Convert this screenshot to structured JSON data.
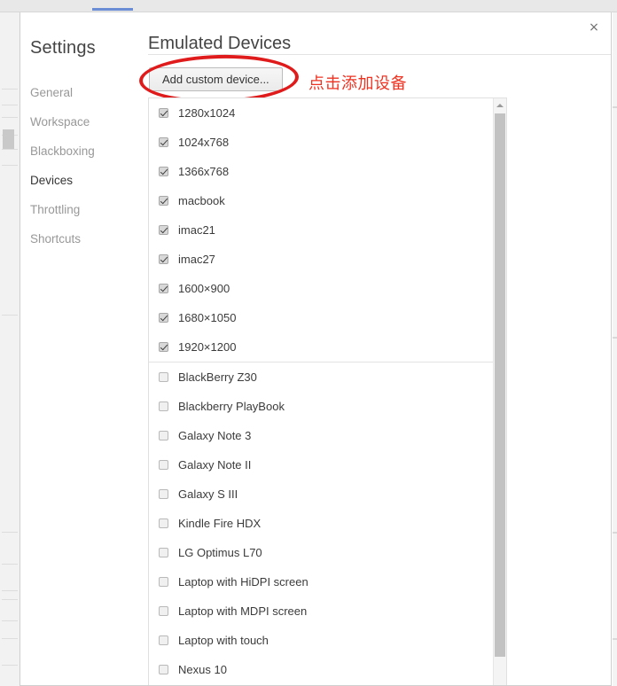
{
  "window": {
    "close_icon": "×"
  },
  "sidebar": {
    "title": "Settings",
    "items": [
      {
        "label": "General",
        "active": false
      },
      {
        "label": "Workspace",
        "active": false
      },
      {
        "label": "Blackboxing",
        "active": false
      },
      {
        "label": "Devices",
        "active": true
      },
      {
        "label": "Throttling",
        "active": false
      },
      {
        "label": "Shortcuts",
        "active": false
      }
    ]
  },
  "main": {
    "panel_title": "Emulated Devices",
    "add_custom_device_label": "Add custom device...",
    "annotation": {
      "text": "点击添加设备",
      "color": "#ee3322"
    },
    "device_groups": [
      {
        "name": "enabled-devices",
        "devices": [
          {
            "label": "1280x1024",
            "checked": true
          },
          {
            "label": "1024x768",
            "checked": true
          },
          {
            "label": "1366x768",
            "checked": true
          },
          {
            "label": "macbook",
            "checked": true
          },
          {
            "label": "imac21",
            "checked": true
          },
          {
            "label": "imac27",
            "checked": true
          },
          {
            "label": "1600×900",
            "checked": true
          },
          {
            "label": "1680×1050",
            "checked": true
          },
          {
            "label": "1920×1200",
            "checked": true
          }
        ]
      },
      {
        "name": "standard-devices",
        "devices": [
          {
            "label": "BlackBerry Z30",
            "checked": false
          },
          {
            "label": "Blackberry PlayBook",
            "checked": false
          },
          {
            "label": "Galaxy Note 3",
            "checked": false
          },
          {
            "label": "Galaxy Note II",
            "checked": false
          },
          {
            "label": "Galaxy S III",
            "checked": false
          },
          {
            "label": "Kindle Fire HDX",
            "checked": false
          },
          {
            "label": "LG Optimus L70",
            "checked": false
          },
          {
            "label": "Laptop with HiDPI screen",
            "checked": false
          },
          {
            "label": "Laptop with MDPI screen",
            "checked": false
          },
          {
            "label": "Laptop with touch",
            "checked": false
          },
          {
            "label": "Nexus 10",
            "checked": false
          }
        ]
      }
    ],
    "scrollbar": {
      "up_arrow_icon": "scroll-up-arrow"
    }
  },
  "theme": {
    "accent_red": "#e01b1b",
    "text_primary": "#3b3b3b",
    "text_muted": "#989898"
  }
}
